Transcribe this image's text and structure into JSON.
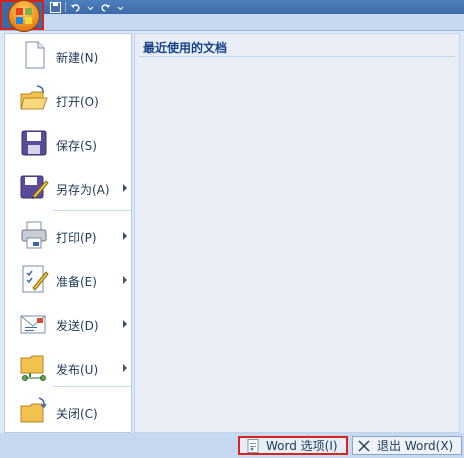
{
  "quick_access": {
    "icons": [
      "save-icon",
      "undo-icon",
      "redo-icon",
      "customize-icon"
    ]
  },
  "menu": {
    "items": [
      {
        "label": "新建(N)",
        "icon": "new-document-icon",
        "submenu": false
      },
      {
        "label": "打开(O)",
        "icon": "open-folder-icon",
        "submenu": false
      },
      {
        "label": "保存(S)",
        "icon": "floppy-save-icon",
        "submenu": false
      },
      {
        "label": "另存为(A)",
        "icon": "save-as-icon",
        "submenu": true
      },
      {
        "label": "打印(P)",
        "icon": "printer-icon",
        "submenu": true
      },
      {
        "label": "准备(E)",
        "icon": "prepare-icon",
        "submenu": true
      },
      {
        "label": "发送(D)",
        "icon": "send-icon",
        "submenu": true
      },
      {
        "label": "发布(U)",
        "icon": "publish-icon",
        "submenu": true
      },
      {
        "label": "关闭(C)",
        "icon": "close-folder-icon",
        "submenu": false
      }
    ]
  },
  "recent": {
    "title": "最近使用的文档"
  },
  "footer": {
    "options_label": "Word 选项(I)",
    "exit_label": "退出 Word(X)"
  },
  "colors": {
    "highlight_border": "#d9241c",
    "accent": "#15428b"
  }
}
